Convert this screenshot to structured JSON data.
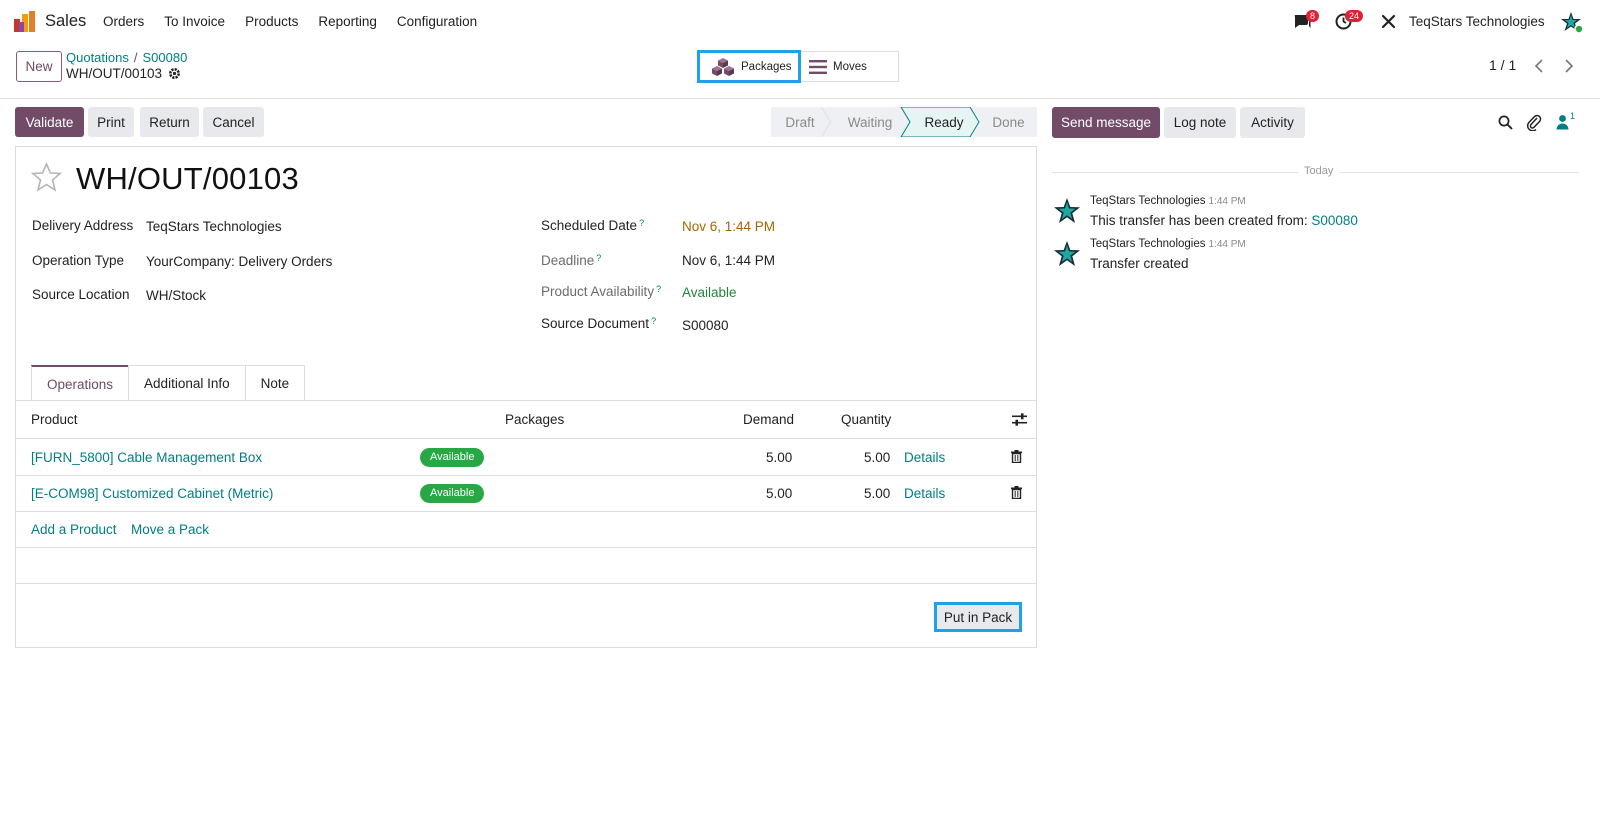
{
  "navbar": {
    "app_name": "Sales",
    "menu": [
      "Orders",
      "To Invoice",
      "Products",
      "Reporting",
      "Configuration"
    ],
    "messages_badge": "8",
    "activities_badge": "24",
    "company": "TeqStars Technologies"
  },
  "control_panel": {
    "new_label": "New",
    "breadcrumb": [
      "Quotations",
      "S00080"
    ],
    "record_name": "WH/OUT/00103",
    "smart_buttons": {
      "packages": "Packages",
      "moves": "Moves"
    },
    "pager": "1 / 1"
  },
  "actions": {
    "validate": "Validate",
    "print": "Print",
    "return": "Return",
    "cancel": "Cancel"
  },
  "statusbar": {
    "stages": [
      "Draft",
      "Waiting",
      "Ready",
      "Done"
    ],
    "current": "Ready"
  },
  "form": {
    "title": "WH/OUT/00103",
    "fields_left": [
      {
        "label": "Delivery Address",
        "value": "TeqStars Technologies"
      },
      {
        "label": "Operation Type",
        "value": "YourCompany: Delivery Orders"
      },
      {
        "label": "Source Location",
        "value": "WH/Stock"
      }
    ],
    "fields_right": [
      {
        "label": "Scheduled Date",
        "value": "Nov 6, 1:44 PM"
      },
      {
        "label": "Deadline",
        "value": "Nov 6, 1:44 PM"
      },
      {
        "label": "Product Availability",
        "value": "Available"
      },
      {
        "label": "Source Document",
        "value": "S00080"
      }
    ],
    "help_mark": "?",
    "tabs": [
      "Operations",
      "Additional Info",
      "Note"
    ],
    "table": {
      "headers": {
        "product": "Product",
        "packages": "Packages",
        "demand": "Demand",
        "quantity": "Quantity"
      },
      "rows": [
        {
          "product": "[FURN_5800] Cable Management Box",
          "status": "Available",
          "demand": "5.00",
          "quantity": "5.00",
          "details": "Details"
        },
        {
          "product": "[E-COM98] Customized Cabinet (Metric)",
          "status": "Available",
          "demand": "5.00",
          "quantity": "5.00",
          "details": "Details"
        }
      ],
      "add_product": "Add a Product",
      "move_pack": "Move a Pack"
    },
    "put_in_pack": "Put in Pack"
  },
  "chatter": {
    "send_message": "Send message",
    "log_note": "Log note",
    "activity": "Activity",
    "followers_count": "1",
    "today": "Today",
    "messages": [
      {
        "author": "TeqStars Technologies",
        "time": "1:44 PM",
        "body": "This transfer has been created from:",
        "link": "S00080"
      },
      {
        "author": "TeqStars Technologies",
        "time": "1:44 PM",
        "body": "Transfer created",
        "link": ""
      }
    ]
  },
  "colors": {
    "primary": "#714b67",
    "link": "#017e84",
    "highlight": "#1ea1e8",
    "available_green": "#28a745",
    "badge_red": "#e31f38"
  }
}
